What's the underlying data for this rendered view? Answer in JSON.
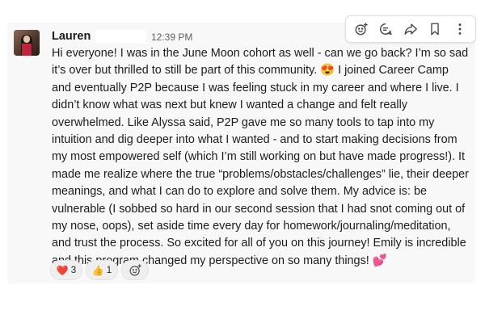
{
  "message": {
    "author": "Lauren",
    "timestamp": "12:39 PM",
    "lines": [
      "Hi everyone! I was in the June Moon cohort as well - can we go back? I’m so sad",
      "it’s over but thrilled to still be part of this community. 😍 I joined Career Camp",
      "and eventually P2P because I was feeling stuck in my career and where I live. I",
      "didn’t know what was next but knew I wanted a change and felt really",
      "overwhelmed. Like Alyssa said, P2P gave me so many tools to tap into my",
      "intuition and dig deeper into what I wanted - and to start making decisions from",
      "my most empowered self (which I’m still working on but have made progress!). It",
      "made me realize where the true “problems/obstacles/challenges” lie, their deeper",
      "meanings, and what I can do to explore and solve them. My advice is: be",
      "vulnerable (I sobbed so hard in our second session that I had snot coming out of",
      "my nose, oops), set aside time every day for homework/journaling/meditation,",
      "and trust the process. So excited for all of you on this journey! Emily is incredible",
      "and this program changed my perspective on so many things! 💕"
    ]
  },
  "toolbar": {
    "icons": [
      "add-reaction-icon",
      "reply-in-thread-icon",
      "forward-icon",
      "bookmark-icon",
      "more-actions-icon"
    ]
  },
  "reactions": [
    {
      "emoji": "❤️",
      "count": "3"
    },
    {
      "emoji": "👍",
      "count": "1"
    }
  ],
  "add_reaction_icon": "add-reaction-icon"
}
